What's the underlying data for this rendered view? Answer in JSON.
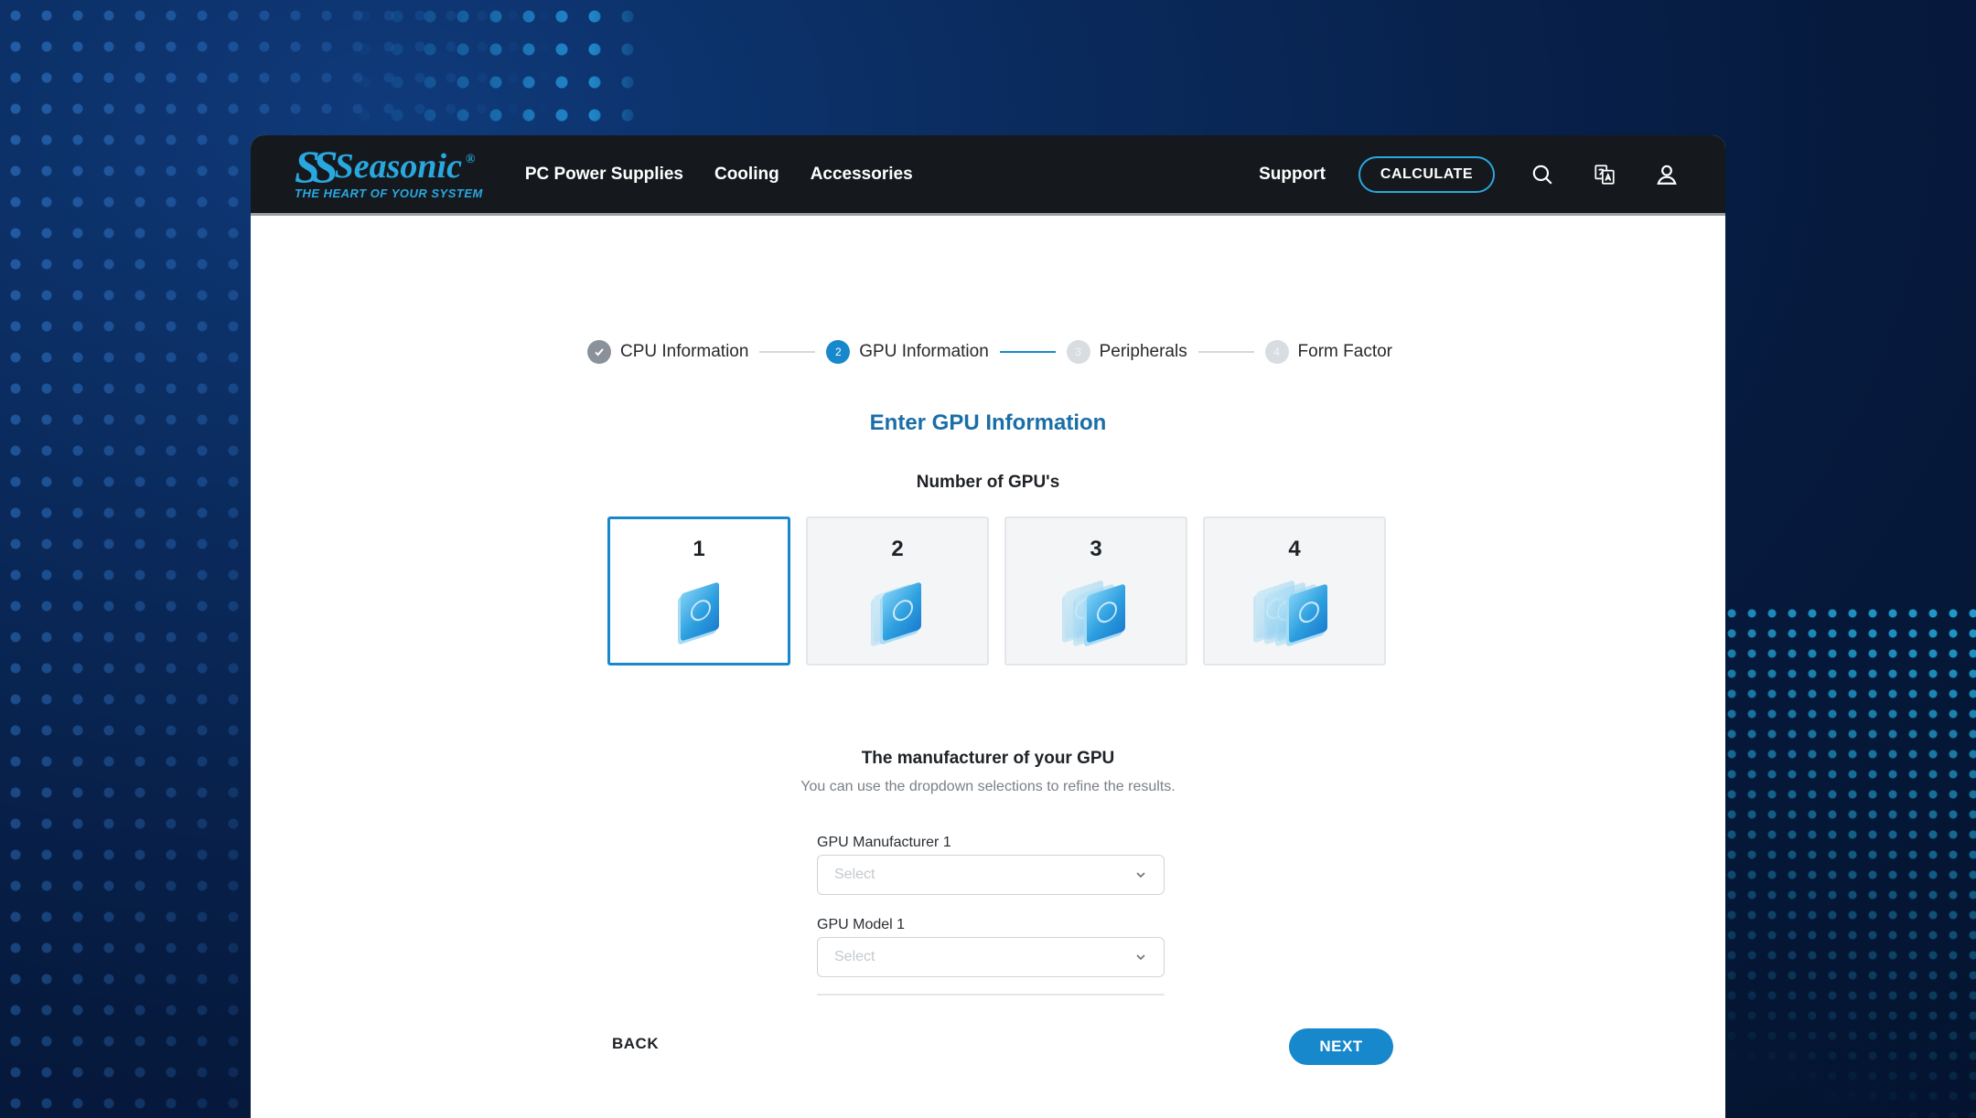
{
  "brand": {
    "mark": "SS",
    "name": "Seasonic",
    "registered": "®",
    "tagline": "THE HEART OF YOUR SYSTEM"
  },
  "nav": {
    "links": [
      "PC Power Supplies",
      "Cooling",
      "Accessories"
    ],
    "support": "Support",
    "calculate": "CALCULATE",
    "icons": [
      "search-icon",
      "language-icon",
      "user-icon"
    ]
  },
  "stepper": {
    "steps": [
      {
        "num": "✓",
        "label": "CPU Information",
        "state": "done"
      },
      {
        "num": "2",
        "label": "GPU Information",
        "state": "active"
      },
      {
        "num": "3",
        "label": "Peripherals",
        "state": "pending"
      },
      {
        "num": "4",
        "label": "Form Factor",
        "state": "pending"
      }
    ]
  },
  "main": {
    "title": "Enter GPU Information",
    "count_label": "Number of GPU's",
    "gpu_options": [
      "1",
      "2",
      "3",
      "4"
    ],
    "selected_option": "1",
    "manufacturer_title": "The manufacturer of your GPU",
    "manufacturer_subtitle": "You can use the dropdown selections to refine the results.",
    "fields": [
      {
        "label": "GPU Manufacturer 1",
        "value": "Select"
      },
      {
        "label": "GPU Model 1",
        "value": "Select"
      }
    ],
    "back_label": "BACK",
    "next_label": "NEXT"
  },
  "colors": {
    "accent": "#1888cc",
    "brand": "#29a8e0",
    "nav_bg": "#15191e",
    "title": "#1a6ea8"
  }
}
